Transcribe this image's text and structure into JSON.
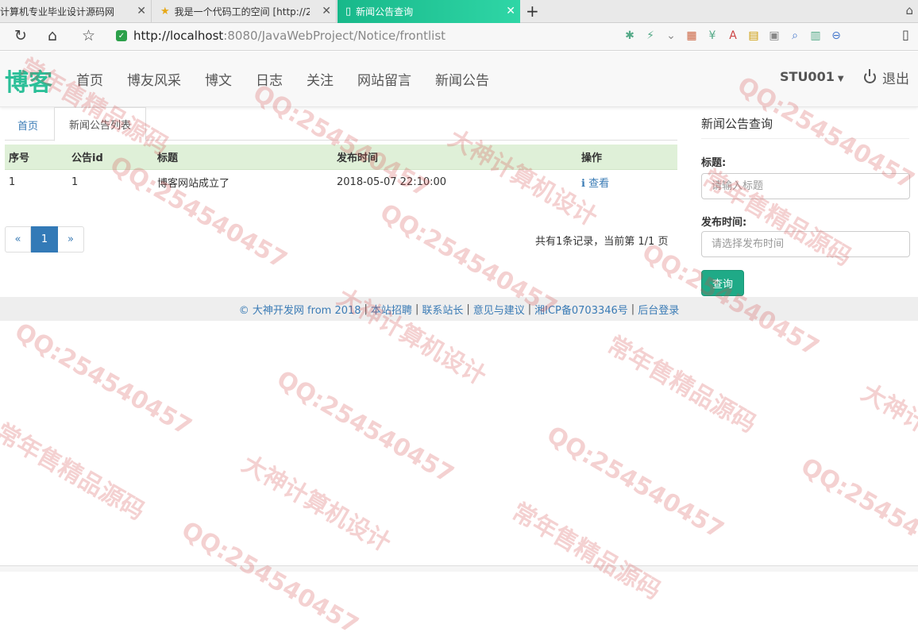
{
  "browser": {
    "tabs": [
      {
        "title": "计算机专业毕业设计源码网"
      },
      {
        "title": "我是一个代码工的空间 [http://2"
      },
      {
        "title": "新闻公告查询"
      }
    ],
    "url_host": "http://localhost",
    "url_path": ":8080/JavaWebProject/Notice/frontlist"
  },
  "site": {
    "brand": "博客",
    "nav": [
      "首页",
      "博友风采",
      "博文",
      "日志",
      "关注",
      "网站留言",
      "新闻公告"
    ],
    "user": "STU001",
    "logout": "退出"
  },
  "breadcrumb": {
    "home": "首页",
    "current": "新闻公告列表"
  },
  "table": {
    "headers": [
      "序号",
      "公告id",
      "标题",
      "发布时间",
      "操作"
    ],
    "rows": [
      {
        "index": "1",
        "id": "1",
        "title": "博客网站成立了",
        "time": "2018-05-07 22:10:00",
        "action": "查看"
      }
    ]
  },
  "pagination": {
    "prev": "«",
    "current": "1",
    "next": "»",
    "info": "共有1条记录，当前第 1/1 页"
  },
  "search": {
    "title": "新闻公告查询",
    "title_label": "标题:",
    "title_placeholder": "请输入标题",
    "time_label": "发布时间:",
    "time_placeholder": "请选择发布时间",
    "button": "查询"
  },
  "footer": {
    "links": [
      "© 大神开发网 from 2018",
      "本站招聘",
      "联系站长",
      "意见与建议",
      "湘ICP备0703346号",
      "后台登录"
    ]
  },
  "watermarks": [
    "QQ:254540457",
    "常年售精品源码",
    "大神计算机设计"
  ],
  "colors": {
    "brand": "#2bbf98",
    "active_tab": "#1fbf90",
    "table_header": "#dff0d8",
    "button": "#1faa87",
    "link": "#3a7bb5"
  }
}
